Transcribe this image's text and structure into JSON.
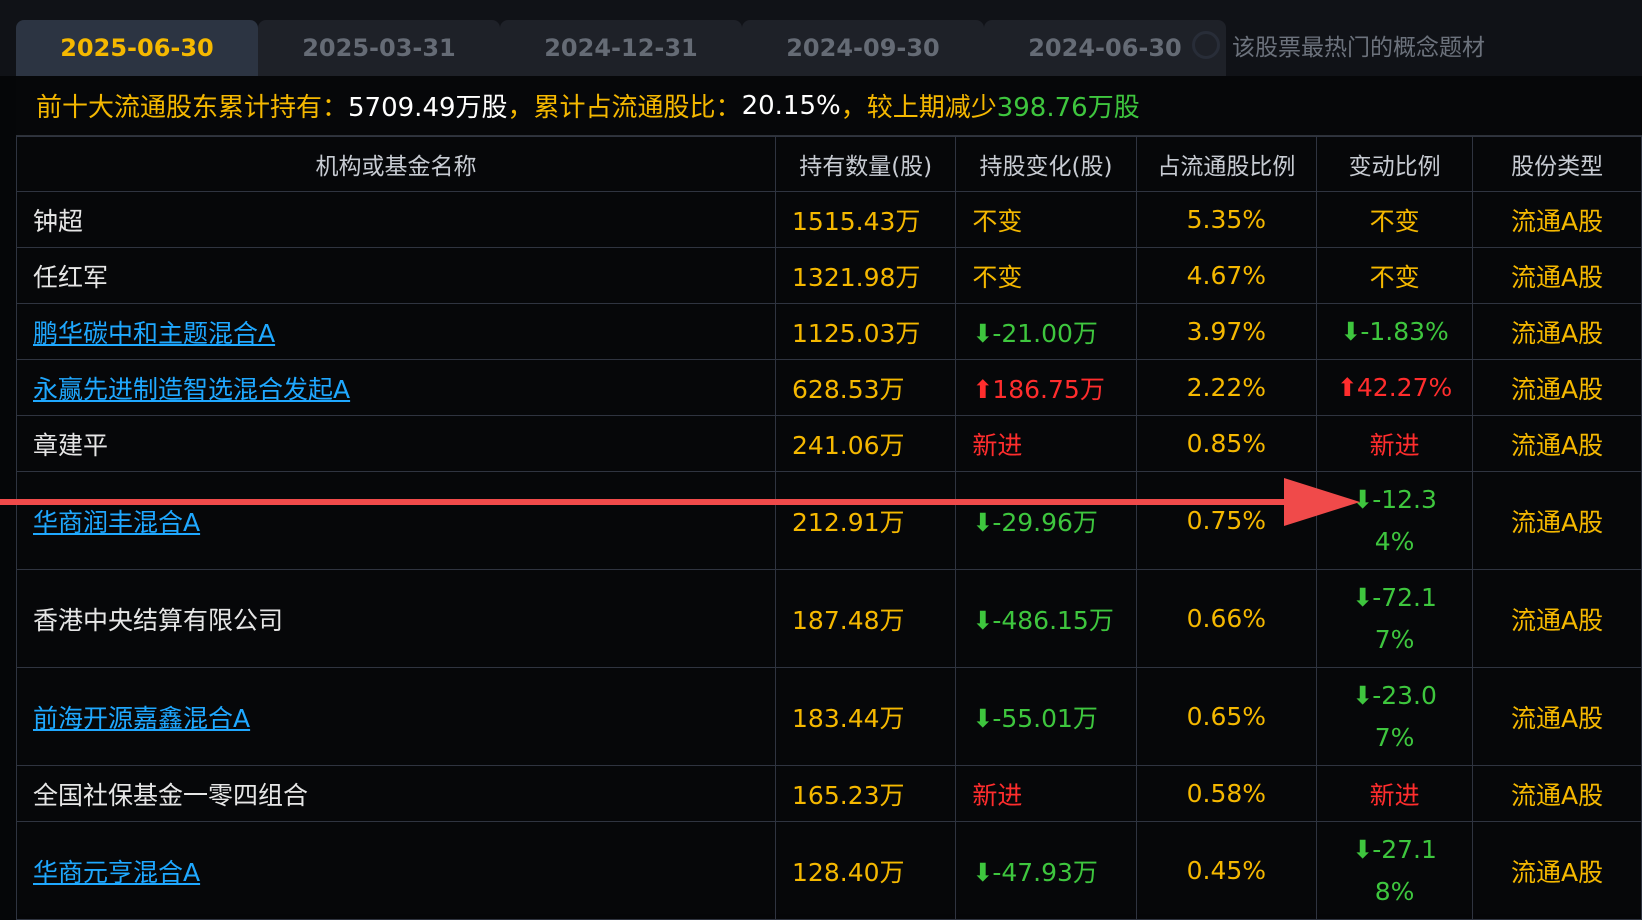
{
  "tabs": [
    {
      "label": "2025-06-30",
      "active": true
    },
    {
      "label": "2025-03-31",
      "active": false
    },
    {
      "label": "2024-12-31",
      "active": false
    },
    {
      "label": "2024-09-30",
      "active": false
    },
    {
      "label": "2024-06-30",
      "active": false
    }
  ],
  "search": {
    "placeholder": "该股票最热门的概念题材"
  },
  "summary": {
    "label1": "前十大流通股东累计持有：",
    "value1": "5709.49万股",
    "label2": "，累计占流通股比：",
    "value2": "20.15%",
    "label3": " ，较上期减少",
    "value3": "398.76万股"
  },
  "table": {
    "headers": [
      "机构或基金名称",
      "持有数量(股)",
      "持股变化(股)",
      "占流通股比例",
      "变动比例",
      "股份类型"
    ],
    "rows": [
      {
        "name": "钟超",
        "link": false,
        "hold": "1515.43万",
        "change": "不变",
        "change_cls": "same",
        "ratio": "5.35%",
        "var": "不变",
        "var_cls": "same",
        "type": "流通A股"
      },
      {
        "name": "任红军",
        "link": false,
        "hold": "1321.98万",
        "change": "不变",
        "change_cls": "same",
        "ratio": "4.67%",
        "var": "不变",
        "var_cls": "same",
        "type": "流通A股"
      },
      {
        "name": "鹏华碳中和主题混合A",
        "link": true,
        "hold": "1125.03万",
        "change": "-21.00万",
        "change_cls": "down",
        "ratio": "3.97%",
        "var": "-1.83%",
        "var_cls": "down",
        "type": "流通A股"
      },
      {
        "name": "永赢先进制造智选混合发起A",
        "link": true,
        "hold": "628.53万",
        "change": "186.75万",
        "change_cls": "up",
        "ratio": "2.22%",
        "var": "42.27%",
        "var_cls": "up",
        "type": "流通A股"
      },
      {
        "name": "章建平",
        "link": false,
        "hold": "241.06万",
        "change": "新进",
        "change_cls": "new",
        "ratio": "0.85%",
        "var": "新进",
        "var_cls": "new",
        "type": "流通A股"
      },
      {
        "name": "华商润丰混合A",
        "link": true,
        "hold": "212.91万",
        "change": "-29.96万",
        "change_cls": "down",
        "ratio": "0.75%",
        "var": "-12.34%",
        "var_cls": "down",
        "type": "流通A股"
      },
      {
        "name": "香港中央结算有限公司",
        "link": false,
        "hold": "187.48万",
        "change": "-486.15万",
        "change_cls": "down",
        "ratio": "0.66%",
        "var": "-72.17%",
        "var_cls": "down",
        "type": "流通A股"
      },
      {
        "name": "前海开源嘉鑫混合A",
        "link": true,
        "hold": "183.44万",
        "change": "-55.01万",
        "change_cls": "down",
        "ratio": "0.65%",
        "var": "-23.07%",
        "var_cls": "down",
        "type": "流通A股"
      },
      {
        "name": "全国社保基金一零四组合",
        "link": false,
        "hold": "165.23万",
        "change": "新进",
        "change_cls": "new",
        "ratio": "0.58%",
        "var": "新进",
        "var_cls": "new",
        "type": "流通A股"
      },
      {
        "name": "华商元亨混合A",
        "link": true,
        "hold": "128.40万",
        "change": "-47.93万",
        "change_cls": "down",
        "ratio": "0.45%",
        "var": "-27.18%",
        "var_cls": "down",
        "type": "流通A股"
      }
    ]
  },
  "colors": {
    "accent": "#f5b800",
    "down": "#3ec63e",
    "up": "#ff2d2d",
    "link": "#1fa8ff",
    "annotation": "#f04a4a"
  },
  "annotation": {
    "icon": "red-arrow-icon"
  }
}
